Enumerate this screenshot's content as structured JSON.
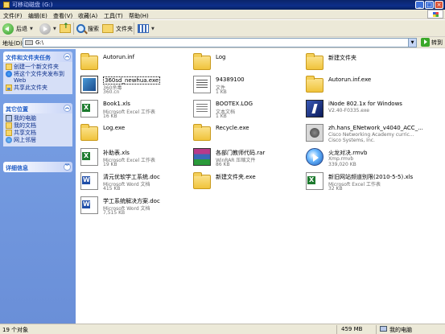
{
  "window": {
    "title": "可移动磁盘 (G:)",
    "controls": [
      "_",
      "□",
      "×"
    ]
  },
  "menu": [
    "文件(F)",
    "编辑(E)",
    "查看(V)",
    "收藏(A)",
    "工具(T)",
    "帮助(H)"
  ],
  "toolbar": {
    "back_label": "后退",
    "search_label": "搜索",
    "folders_label": "文件夹"
  },
  "address": {
    "label": "地址(D)",
    "value": "G:\\",
    "go_label": "转到"
  },
  "tasks": {
    "file_tasks": {
      "title": "文件和文件夹任务",
      "items": [
        "创建一个新文件夹",
        "将这个文件夹发布到 Web",
        "共享此文件夹"
      ]
    },
    "other_places": {
      "title": "其它位置",
      "items": [
        "我的电脑",
        "我的文档",
        "共享文档",
        "网上邻居"
      ]
    },
    "details": {
      "title": "详细信息"
    }
  },
  "files": [
    {
      "name": "Autorun.inf",
      "type": "",
      "size": "",
      "icon": "folder-icon"
    },
    {
      "name": "Log",
      "type": "",
      "size": "",
      "icon": "folder-icon"
    },
    {
      "name": "新建文件夹",
      "type": "",
      "size": "",
      "icon": "folder-icon"
    },
    {
      "name": "360sd_newhua.exe",
      "type": "360杀毒",
      "size": "360.cn",
      "icon": "exe-icon"
    },
    {
      "name": "94389100",
      "type": "文件",
      "size": "1 KB",
      "icon": "file-icon"
    },
    {
      "name": "Autorun.inf.exe",
      "type": "",
      "size": "",
      "icon": "folder-icon"
    },
    {
      "name": "Book1.xls",
      "type": "Microsoft Excel 工作表",
      "size": "16 KB",
      "icon": "excel-icon"
    },
    {
      "name": "BOOTEX.LOG",
      "type": "文本文档",
      "size": "1 KB",
      "icon": "text-file-icon"
    },
    {
      "name": "iNode 802.1x for Windows",
      "type": "V2.40-F0335.exe",
      "size": "",
      "icon": "inode-icon"
    },
    {
      "name": "Log.exe",
      "type": "",
      "size": "",
      "icon": "folder-icon"
    },
    {
      "name": "Recycle.exe",
      "type": "",
      "size": "",
      "icon": "folder-icon"
    },
    {
      "name": "zh.hans_ENetwork_v4040_ACC_...",
      "type": "Cisco Networking Academy curric...",
      "size": "Cisco Systems, Inc.",
      "icon": "cisco-icon"
    },
    {
      "name": "补助表.xls",
      "type": "Microsoft Excel 工作表",
      "size": "19 KB",
      "icon": "excel-icon"
    },
    {
      "name": "各部门教师代码.rar",
      "type": "WinRAR 压缩文件",
      "size": "86 KB",
      "icon": "rar-icon"
    },
    {
      "name": "火龙对决.rmvb",
      "type": "Xmp.rmvb",
      "size": "339,020 KB",
      "icon": "media-icon"
    },
    {
      "name": "清元优软学工系统.doc",
      "type": "Microsoft Word 文档",
      "size": "415 KB",
      "icon": "word-icon"
    },
    {
      "name": "新建文件夹.exe",
      "type": "",
      "size": "",
      "icon": "folder-icon"
    },
    {
      "name": "新旧网站频道别限(2010-5-5).xls",
      "type": "Microsoft Excel 工作表",
      "size": "32 KB",
      "icon": "excel-icon"
    },
    {
      "name": "学工系统解决方案.doc",
      "type": "Microsoft Word 文档",
      "size": "7,515 KB",
      "icon": "word-icon"
    }
  ],
  "status": {
    "count": "19 个对象",
    "size": "459 MB",
    "location": "我的电脑"
  }
}
